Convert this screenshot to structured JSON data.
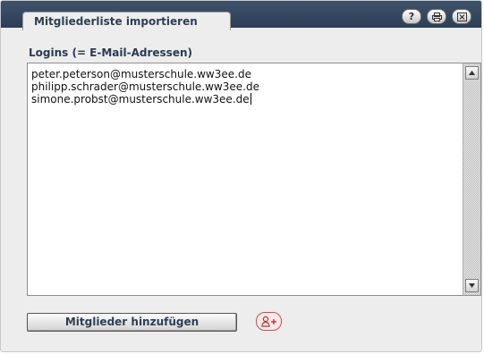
{
  "dialog": {
    "title": "Mitgliederliste importieren",
    "toolbar": {
      "help_icon": "help-icon",
      "print_icon": "print-icon",
      "close_icon": "close-icon"
    }
  },
  "form": {
    "logins_label": "Logins (= E-Mail-Adressen)",
    "logins_value": "peter.peterson@musterschule.ww3ee.de\nphilipp.schrader@musterschule.ww3ee.de\nsimone.probst@musterschule.ww3ee.de"
  },
  "actions": {
    "add_members_label": "Mitglieder hinzufügen",
    "add_member_icon": "person-add-icon"
  },
  "colors": {
    "titlebar": "#34475e",
    "accent": "#d04a4a"
  }
}
